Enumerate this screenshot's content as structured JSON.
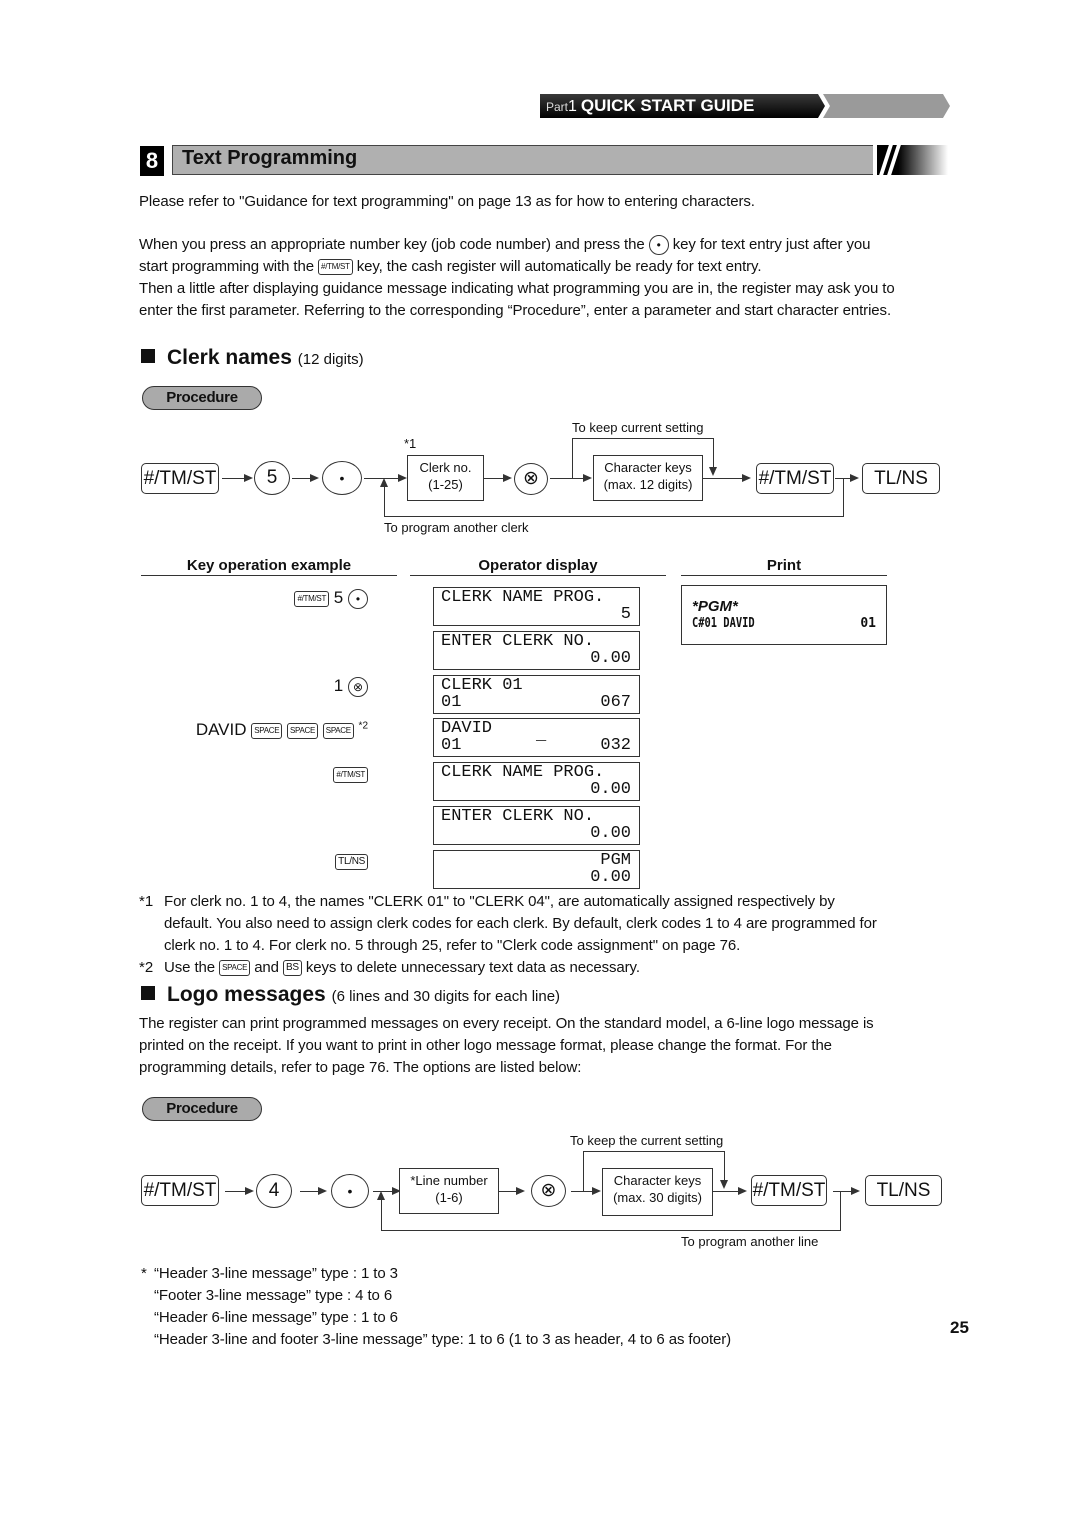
{
  "header": {
    "part_label": "Part",
    "part_number": "1",
    "guide_title": "QUICK START GUIDE"
  },
  "section": {
    "number": "8",
    "title": "Text Programming"
  },
  "intro": {
    "p1": "Please refer to \"Guidance for text programming\" on page 13 as for how to entering characters.",
    "p2_a": "When you press an appropriate number key (job code number) and press the",
    "p2_b": "key for text entry just after you",
    "p2_c": "start programming with the",
    "p2_d": "key, the cash register will automatically be ready for text entry.",
    "p3_line1": "Then a little after displaying guidance message indicating what programming you are in, the register may ask you to",
    "p3_line2": "enter the first parameter.  Referring to the corresponding “Procedure”, enter a parameter and start character entries."
  },
  "keys": {
    "tmst": "#/TM/ST",
    "tlns": "TL/NS",
    "dot": "•",
    "multiply": "⊗",
    "space": "SPACE",
    "bs": "BS"
  },
  "clerk": {
    "heading": "Clerk names",
    "heading_note": "(12 digits)",
    "procedure_label": "Procedure",
    "diagram": {
      "key_5": "5",
      "footnote_ref": "*1",
      "clerk_box_l1": "Clerk no.",
      "clerk_box_l2": "(1-25)",
      "char_box_l1": "Character keys",
      "char_box_l2": "(max. 12 digits)",
      "keep_label": "To keep current setting",
      "loop_label": "To program another clerk"
    },
    "table": {
      "col_key": "Key operation example",
      "col_display": "Operator display",
      "col_print": "Print",
      "keyops": {
        "r1_num": "5",
        "r3_num": "1",
        "r4_text": "DAVID",
        "r4_note": "*2"
      },
      "displays": [
        {
          "line1": "CLERK NAME PROG.",
          "line2_left": "",
          "line2_right": "5"
        },
        {
          "line1": "ENTER CLERK NO.",
          "line2_left": "",
          "line2_right": "0.00"
        },
        {
          "line1": "CLERK 01",
          "line2_left": "01",
          "line2_right": "067"
        },
        {
          "line1": "DAVID",
          "line2_left": "01",
          "line2_mid": "_",
          "line2_right": "032"
        },
        {
          "line1": "CLERK NAME PROG.",
          "line2_left": "",
          "line2_right": "0.00"
        },
        {
          "line1": "ENTER CLERK NO.",
          "line2_left": "",
          "line2_right": "0.00"
        },
        {
          "line1": "PGM",
          "line2_left": "",
          "line2_right": "0.00"
        }
      ],
      "print": {
        "line1": "*PGM*",
        "line2_left": "C#01 DAVID",
        "line2_right": "01"
      }
    },
    "footnotes": {
      "n1_mark": "*1",
      "n1_l1": "For clerk no. 1 to 4, the names \"CLERK 01\" to \"CLERK 04\", are automatically assigned respectively by",
      "n1_l2": "default. You also need to assign clerk codes for each clerk. By default, clerk codes 1 to 4 are programmed for",
      "n1_l3": "clerk no. 1 to 4. For clerk no. 5 through 25, refer to \"Clerk code assignment\" on page 76.",
      "n2_mark": "*2",
      "n2_a": "Use the",
      "n2_b": "and",
      "n2_c": "keys to delete unnecessary text data as necessary."
    }
  },
  "logo": {
    "heading": "Logo messages",
    "heading_note": "(6 lines and 30 digits for each line)",
    "desc_l1": "The register can print programmed messages on every receipt. On the standard model, a 6-line logo message is",
    "desc_l2": "printed on the receipt.  If you want to print in other logo message format, please change the format. For the",
    "desc_l3": "programming details, refer to page 76.  The options are listed below:",
    "procedure_label": "Procedure",
    "diagram": {
      "key_4": "4",
      "line_box_l1": "*Line number",
      "line_box_l2": "(1-6)",
      "char_box_l1": "Character keys",
      "char_box_l2": "(max. 30 digits)",
      "keep_label": "To keep the current setting",
      "loop_label": "To program another line"
    },
    "options_mark": "*",
    "options": [
      "“Header 3-line message” type : 1 to 3",
      "“Footer 3-line message” type  : 4 to 6",
      "“Header 6-line message” type : 1 to 6",
      "“Header 3-line and footer 3-line message” type: 1 to 6 (1 to 3 as header, 4 to 6 as footer)"
    ]
  },
  "page_number": "25"
}
